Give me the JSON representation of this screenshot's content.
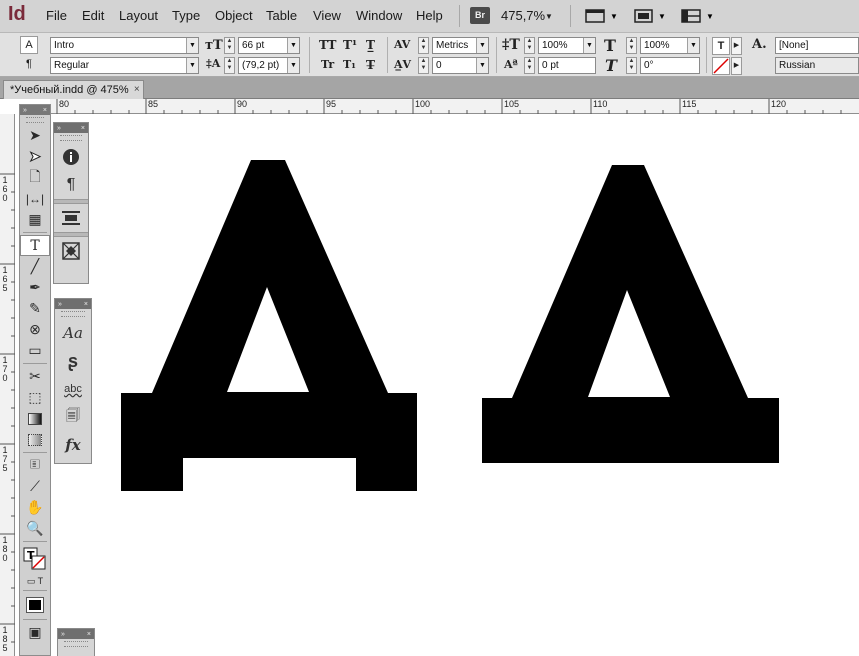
{
  "app": {
    "logo": "Id"
  },
  "menu": {
    "items": [
      "File",
      "Edit",
      "Layout",
      "Type",
      "Object",
      "Table",
      "View",
      "Window",
      "Help"
    ],
    "bridge_badge": "Br",
    "zoom": "475,7%"
  },
  "control": {
    "font_family": "Intro",
    "font_style": "Regular",
    "font_size": "66 pt",
    "leading": "(79,2 pt)",
    "kerning": "Metrics",
    "tracking": "0",
    "vertical_scale": "100%",
    "horizontal_scale": "100%",
    "baseline_shift": "0 pt",
    "skew": "0°",
    "char_style": "[None]",
    "language": "Russian"
  },
  "document_tab": {
    "label": "*Учебный.indd @ 475%"
  },
  "ruler": {
    "h_ticks": [
      "80",
      "85",
      "90",
      "95",
      "100",
      "105",
      "110",
      "115",
      "120"
    ],
    "v_ticks": [
      "160",
      "165",
      "170",
      "175",
      "180",
      "185"
    ]
  },
  "canvas": {
    "letters": [
      {
        "char": "Д",
        "description_font": "serif-like slab"
      },
      {
        "char": "Д",
        "description_font": "sans geometric"
      }
    ]
  },
  "icons": {
    "tools": [
      "selection-icon",
      "direct-selection-icon",
      "page-icon",
      "gap-icon",
      "content-collector-icon",
      "type-icon",
      "line-icon",
      "pen-icon",
      "pencil-icon",
      "ellipse-frame-icon",
      "rectangle-icon",
      "scissors-icon",
      "free-transform-icon",
      "gradient-swatch-icon",
      "gradient-feather-icon",
      "note-icon",
      "eyedropper-icon",
      "hand-icon",
      "zoom-icon"
    ]
  }
}
